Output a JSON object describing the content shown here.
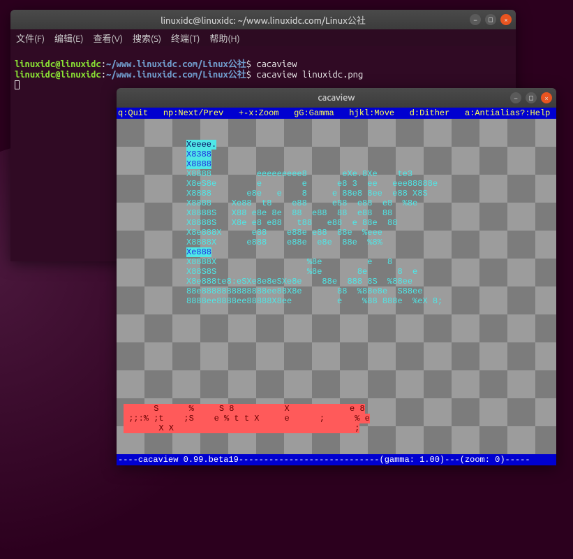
{
  "desktop": {
    "os": "Ubuntu"
  },
  "terminal_window": {
    "title": "linuxidc@linuxidc: ~/www.linuxidc.com/Linux公社",
    "menu": [
      "文件(F)",
      "编辑(E)",
      "查看(V)",
      "搜索(S)",
      "终端(T)",
      "帮助(H)"
    ],
    "prompt_user": "linuxidc@linuxidc",
    "prompt_sep": ":",
    "prompt_path": "~/www.linuxidc.com/Linux公社",
    "prompt_end": "$",
    "commands": [
      "cacaview",
      "cacaview linuxidc.png"
    ]
  },
  "cacaview_window": {
    "title": "cacaview",
    "help_bar": {
      "q": "q:Quit",
      "np": "np:Next/Prev",
      "zoom": "+-x:Zoom",
      "gamma": "gG:Gamma",
      "move": "hjkl:Move",
      "dither": "d:Dither",
      "aa": "a:Antialias",
      "help": "?:Help"
    },
    "status_bar": {
      "app": "cacaview 0.99.beta19",
      "gamma_label": "gamma:",
      "gamma_value": "1.00",
      "zoom_label": "zoom:",
      "zoom_value": "0"
    },
    "ascii_rows": [
      "Xeeee.",
      "X8388",
      "X8888",
      "X8888         eeeeeeeee8       eXe.8Xe    te3",
      "X8eS8e        e        e      e8 3  ee   eee88888e",
      "X8888       e8e   e    8     e 88e8 8ee  e88 X8S",
      "X8888    Xe88  t8    e88     e88  e88  e8  %8e",
      "X8888S   X88 e8e 8e  88  e88  88  e88  88",
      "X8888S   X8e e8 e88   t88   e88  e 88e  88",
      "X8e888X      e88    e88e e88  88e  %eee",
      "X8888X      e888    e88e  e8e  88e  %8%",
      "Xe888",
      "X8888X                  %8e         e   8",
      "X88S8S                  %8e       8e      8  e",
      "X8e888te8:eSXe8e8eSXe8e    88e  888 8S  %88ee",
      "88e8888888888888ee88X8e       88  %88e8e  S88ee",
      "8888ee8888ee88888X8ee         e    %88 888e  %eX 8;",
      "",
      "      S      %     S 8          X            e 8",
      " ;;:% ;t    ;S    e % t t X     e      ;      % e",
      "       X X                                    ;"
    ]
  },
  "window_controls": {
    "minimize": "−",
    "maximize": "□",
    "close": "×"
  }
}
